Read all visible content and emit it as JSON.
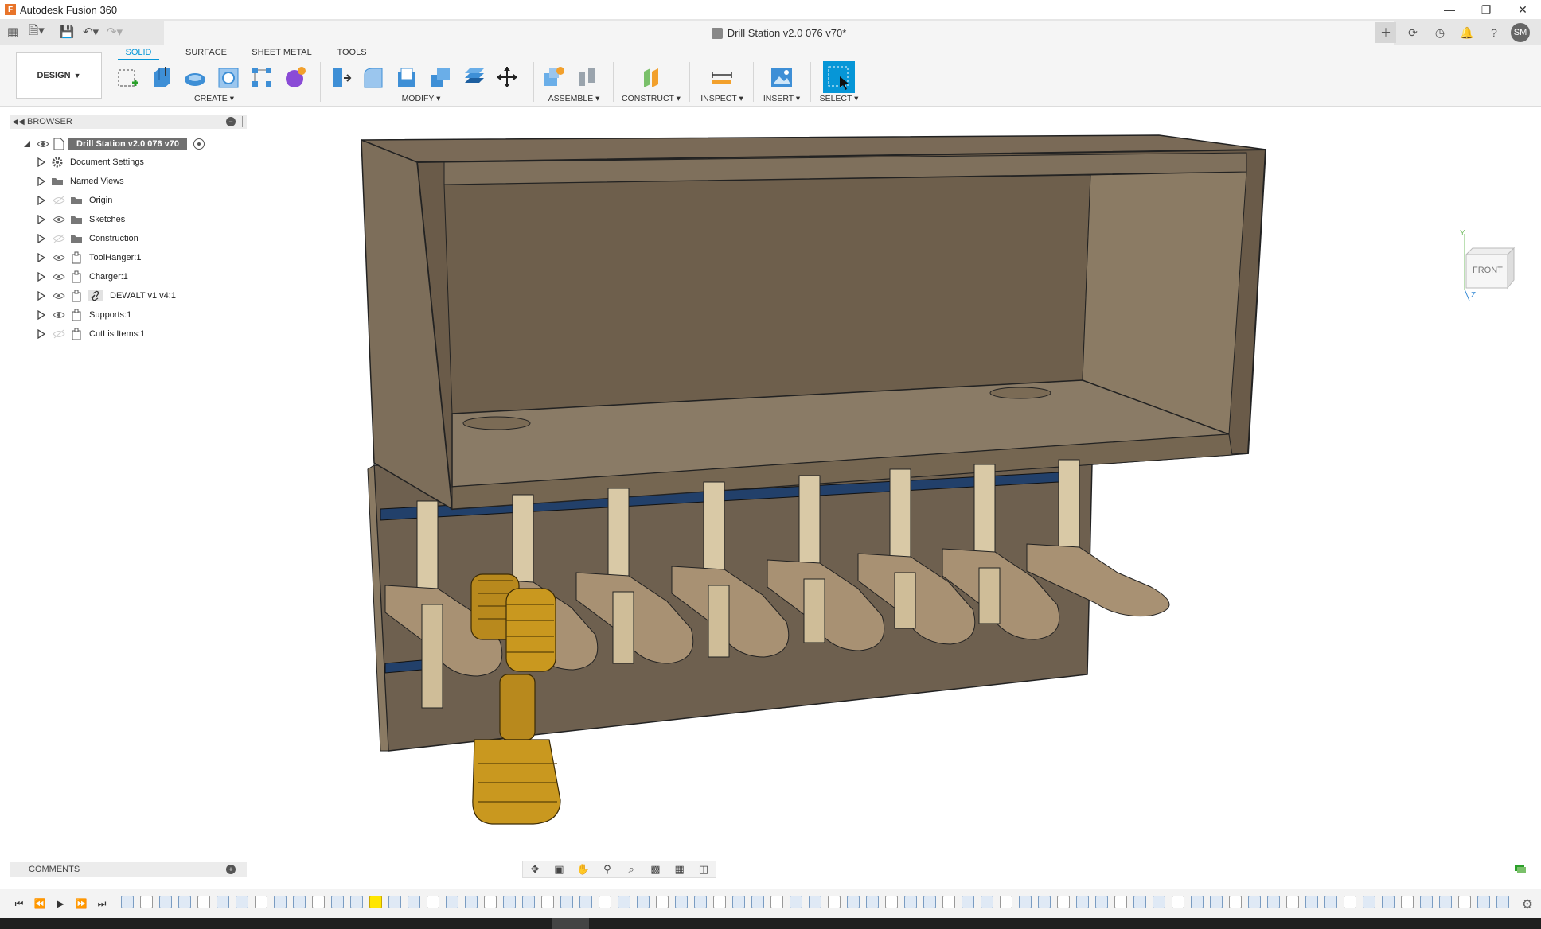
{
  "window": {
    "title": "Autodesk Fusion 360",
    "document_title": "Drill Station v2.0 076 v70*",
    "user_initials": "SM"
  },
  "ribbon": {
    "workspace": "DESIGN",
    "tabs": [
      {
        "label": "SOLID",
        "active": true
      },
      {
        "label": "SURFACE",
        "active": false
      },
      {
        "label": "SHEET METAL",
        "active": false
      },
      {
        "label": "TOOLS",
        "active": false
      }
    ],
    "groups": {
      "create": "CREATE",
      "modify": "MODIFY",
      "assemble": "ASSEMBLE",
      "construct": "CONSTRUCT",
      "inspect": "INSPECT",
      "insert": "INSERT",
      "select": "SELECT"
    }
  },
  "browser": {
    "header": "BROWSER",
    "root": "Drill Station v2.0 076 v70",
    "items": [
      {
        "label": "Document Settings",
        "icon": "gear-icon",
        "visible": true
      },
      {
        "label": "Named Views",
        "icon": "folder-icon",
        "visible": true
      },
      {
        "label": "Origin",
        "icon": "folder-icon",
        "visible": false
      },
      {
        "label": "Sketches",
        "icon": "folder-icon",
        "visible": true
      },
      {
        "label": "Construction",
        "icon": "folder-icon",
        "visible": false
      },
      {
        "label": "ToolHanger:1",
        "icon": "component-icon",
        "visible": true
      },
      {
        "label": "Charger:1",
        "icon": "component-icon",
        "visible": true
      },
      {
        "label": "DEWALT v1 v4:1",
        "icon": "link-icon",
        "visible": true
      },
      {
        "label": "Supports:1",
        "icon": "component-icon",
        "visible": true
      },
      {
        "label": "CutListItems:1",
        "icon": "component-icon",
        "visible": false
      }
    ]
  },
  "viewcube": {
    "face": "FRONT",
    "axis_y": "Y",
    "axis_z": "Z"
  },
  "comments": {
    "header": "COMMENTS"
  },
  "colors": {
    "accent": "#0696d7",
    "wood_dark": "#6e604f",
    "wood_light": "#c9b48e"
  }
}
